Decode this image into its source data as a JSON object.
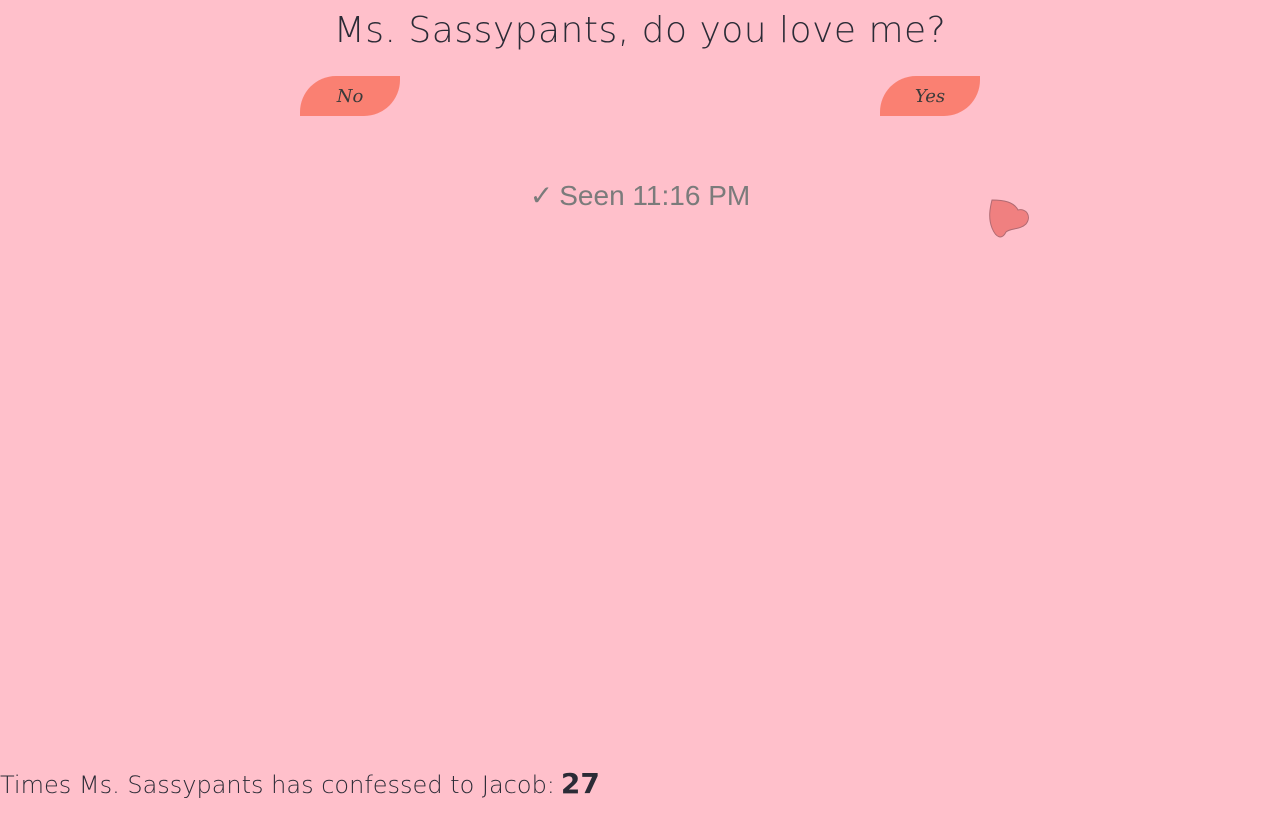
{
  "header": {
    "title": "Ms. Sassypants, do you love me?"
  },
  "buttons": {
    "no_label": "No",
    "yes_label": "Yes"
  },
  "status": {
    "check_glyph": "✓",
    "seen_text": "Seen 11:16 PM"
  },
  "heart": {
    "icon": "heart-icon",
    "color": "#f08080"
  },
  "footer": {
    "label": "Times Ms. Sassypants has confessed to Jacob:",
    "count": "27"
  },
  "colors": {
    "background": "#ffc0cb",
    "button": "#fa8072",
    "text": "#2b2b36",
    "status_text": "#7b7b7b"
  }
}
